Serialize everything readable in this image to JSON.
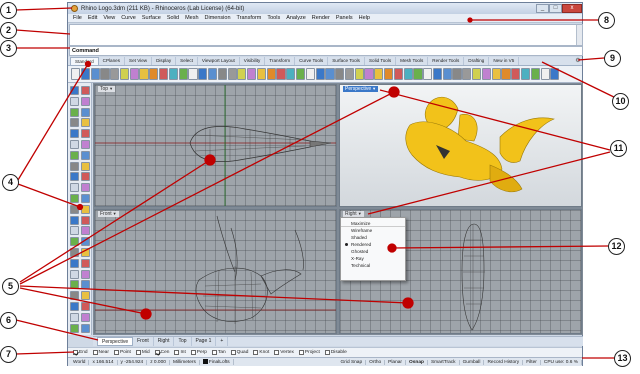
{
  "titlebar": {
    "title": "Rhino Logo.3dm (211 KB) - Rhinoceros (Lab License) (64-bit)",
    "minimize": "_",
    "maximize": "□",
    "close": "x"
  },
  "menu": [
    "File",
    "Edit",
    "View",
    "Curve",
    "Surface",
    "Solid",
    "Mesh",
    "Dimension",
    "Transform",
    "Tools",
    "Analyze",
    "Render",
    "Panels",
    "Help"
  ],
  "command": {
    "prompt": "Command"
  },
  "toolbar_tabs": [
    "Standard",
    "CPlanes",
    "Set View",
    "Display",
    "Select",
    "Viewport Layout",
    "Visibility",
    "Transform",
    "Curve Tools",
    "Surface Tools",
    "Solid Tools",
    "Mesh Tools",
    "Render Tools",
    "Drafting",
    "New in V5"
  ],
  "viewports": {
    "top": "Top",
    "perspective": "Perspective",
    "front": "Front",
    "right": "Right"
  },
  "context_menu": [
    "Maximize",
    "Wireframe",
    "Shaded",
    "Rendered",
    "Ghosted",
    "X-Ray",
    "Technical"
  ],
  "viewport_tabs": [
    "Perspective",
    "Front",
    "Right",
    "Top",
    "Page 1",
    "+"
  ],
  "osnaps": [
    {
      "label": "End",
      "checked": true
    },
    {
      "label": "Near",
      "checked": false
    },
    {
      "label": "Point",
      "checked": false
    },
    {
      "label": "Mid",
      "checked": false
    },
    {
      "label": "Cen",
      "checked": true
    },
    {
      "label": "Int",
      "checked": false
    },
    {
      "label": "Perp",
      "checked": false
    },
    {
      "label": "Tan",
      "checked": false
    },
    {
      "label": "Quad",
      "checked": false
    },
    {
      "label": "Knot",
      "checked": false
    },
    {
      "label": "Vertex",
      "checked": false
    },
    {
      "label": "Project",
      "checked": false
    },
    {
      "label": "Disable",
      "checked": false
    }
  ],
  "status": {
    "world": "World",
    "x": "x 166.514",
    "y": "y -254.924",
    "z": "z 0.000",
    "units": "Millimeters",
    "layer": "FinalLofts",
    "grid_snap": "Grid Snap",
    "ortho": "Ortho",
    "planar": "Planar",
    "osnap": "Osnap",
    "smarttrack": "SmartTrack",
    "gumball": "Gumball",
    "record_history": "Record History",
    "filter": "Filter",
    "cpu": "CPU use: 0.6 %"
  },
  "callouts": [
    "1",
    "2",
    "3",
    "4",
    "5",
    "6",
    "7",
    "8",
    "9",
    "10",
    "11",
    "12",
    "13"
  ],
  "colors": {
    "callout_line": "#c00000",
    "model_yellow": "#f2c21a",
    "accent": "#3a78c8"
  }
}
